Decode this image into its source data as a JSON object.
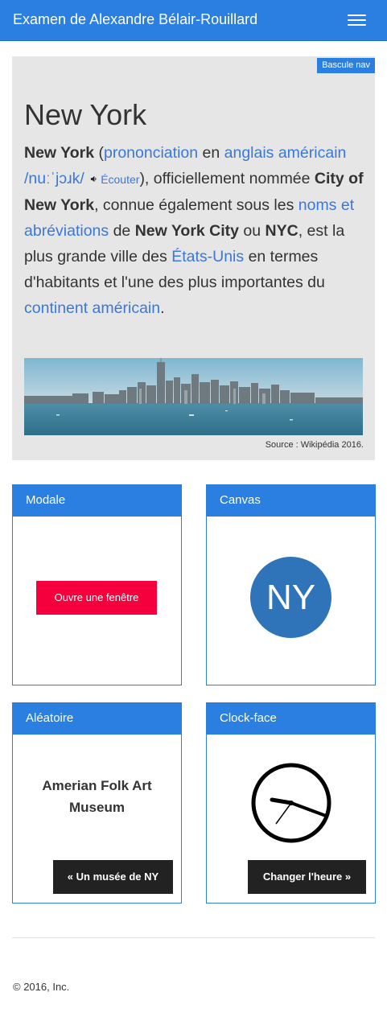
{
  "navbar": {
    "title": "Examen de Alexandre Bélair-Rouillard",
    "menu_icon": "hamburger-menu-icon"
  },
  "hero": {
    "toggle_label": "Bascule nav",
    "title": "New York",
    "paragraph": {
      "t1": "New York",
      "t2": " (",
      "l1": "prononciation",
      "t3": " en ",
      "l2": "anglais américain",
      "t4": " ",
      "l3": "/nuːˈjɔɹk/",
      "t5": " ",
      "speaker_icon": "speaker-icon",
      "l4": "Écouter",
      "t6": "), officiellement nommée ",
      "t7": "City of New York",
      "t8": ", connue également sous les ",
      "l5": "noms et abréviations",
      "t9": " de ",
      "t10": "New York City",
      "t11": " ou ",
      "t12": "NYC",
      "t13": ", est la plus grande ville des ",
      "l6": "États-Unis",
      "t14": " en termes d'habitants et l'une des plus importantes du ",
      "l7": "continent américain",
      "t15": "."
    },
    "source": "Source : Wikipédia 2016."
  },
  "cards": {
    "modal": {
      "title": "Modale",
      "button": "Ouvre une fenêtre"
    },
    "canvas": {
      "title": "Canvas",
      "circle_text": "NY"
    },
    "random": {
      "title": "Aléatoire",
      "museum": "Amerian Folk Art Museum",
      "button": "« Un musée de NY"
    },
    "clock": {
      "title": "Clock-face",
      "button": "Changer l'heure »"
    }
  },
  "footer": {
    "copyright": "© 2016, Inc."
  },
  "colors": {
    "primary": "#2a7fe0",
    "danger": "#f5003d",
    "dark": "#222222",
    "circle": "#2f74b8"
  }
}
